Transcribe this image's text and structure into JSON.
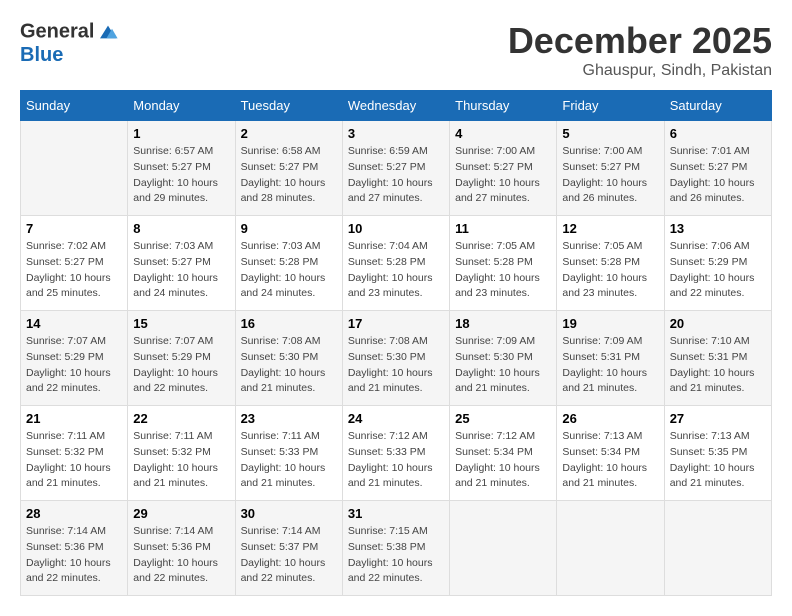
{
  "logo": {
    "line1": "General",
    "line2": "Blue"
  },
  "title": "December 2025",
  "subtitle": "Ghauspur, Sindh, Pakistan",
  "header": {
    "days": [
      "Sunday",
      "Monday",
      "Tuesday",
      "Wednesday",
      "Thursday",
      "Friday",
      "Saturday"
    ]
  },
  "weeks": [
    [
      {
        "day": "",
        "sunrise": "",
        "sunset": "",
        "daylight": ""
      },
      {
        "day": "1",
        "sunrise": "Sunrise: 6:57 AM",
        "sunset": "Sunset: 5:27 PM",
        "daylight": "Daylight: 10 hours and 29 minutes."
      },
      {
        "day": "2",
        "sunrise": "Sunrise: 6:58 AM",
        "sunset": "Sunset: 5:27 PM",
        "daylight": "Daylight: 10 hours and 28 minutes."
      },
      {
        "day": "3",
        "sunrise": "Sunrise: 6:59 AM",
        "sunset": "Sunset: 5:27 PM",
        "daylight": "Daylight: 10 hours and 27 minutes."
      },
      {
        "day": "4",
        "sunrise": "Sunrise: 7:00 AM",
        "sunset": "Sunset: 5:27 PM",
        "daylight": "Daylight: 10 hours and 27 minutes."
      },
      {
        "day": "5",
        "sunrise": "Sunrise: 7:00 AM",
        "sunset": "Sunset: 5:27 PM",
        "daylight": "Daylight: 10 hours and 26 minutes."
      },
      {
        "day": "6",
        "sunrise": "Sunrise: 7:01 AM",
        "sunset": "Sunset: 5:27 PM",
        "daylight": "Daylight: 10 hours and 26 minutes."
      }
    ],
    [
      {
        "day": "7",
        "sunrise": "Sunrise: 7:02 AM",
        "sunset": "Sunset: 5:27 PM",
        "daylight": "Daylight: 10 hours and 25 minutes."
      },
      {
        "day": "8",
        "sunrise": "Sunrise: 7:03 AM",
        "sunset": "Sunset: 5:27 PM",
        "daylight": "Daylight: 10 hours and 24 minutes."
      },
      {
        "day": "9",
        "sunrise": "Sunrise: 7:03 AM",
        "sunset": "Sunset: 5:28 PM",
        "daylight": "Daylight: 10 hours and 24 minutes."
      },
      {
        "day": "10",
        "sunrise": "Sunrise: 7:04 AM",
        "sunset": "Sunset: 5:28 PM",
        "daylight": "Daylight: 10 hours and 23 minutes."
      },
      {
        "day": "11",
        "sunrise": "Sunrise: 7:05 AM",
        "sunset": "Sunset: 5:28 PM",
        "daylight": "Daylight: 10 hours and 23 minutes."
      },
      {
        "day": "12",
        "sunrise": "Sunrise: 7:05 AM",
        "sunset": "Sunset: 5:28 PM",
        "daylight": "Daylight: 10 hours and 23 minutes."
      },
      {
        "day": "13",
        "sunrise": "Sunrise: 7:06 AM",
        "sunset": "Sunset: 5:29 PM",
        "daylight": "Daylight: 10 hours and 22 minutes."
      }
    ],
    [
      {
        "day": "14",
        "sunrise": "Sunrise: 7:07 AM",
        "sunset": "Sunset: 5:29 PM",
        "daylight": "Daylight: 10 hours and 22 minutes."
      },
      {
        "day": "15",
        "sunrise": "Sunrise: 7:07 AM",
        "sunset": "Sunset: 5:29 PM",
        "daylight": "Daylight: 10 hours and 22 minutes."
      },
      {
        "day": "16",
        "sunrise": "Sunrise: 7:08 AM",
        "sunset": "Sunset: 5:30 PM",
        "daylight": "Daylight: 10 hours and 21 minutes."
      },
      {
        "day": "17",
        "sunrise": "Sunrise: 7:08 AM",
        "sunset": "Sunset: 5:30 PM",
        "daylight": "Daylight: 10 hours and 21 minutes."
      },
      {
        "day": "18",
        "sunrise": "Sunrise: 7:09 AM",
        "sunset": "Sunset: 5:30 PM",
        "daylight": "Daylight: 10 hours and 21 minutes."
      },
      {
        "day": "19",
        "sunrise": "Sunrise: 7:09 AM",
        "sunset": "Sunset: 5:31 PM",
        "daylight": "Daylight: 10 hours and 21 minutes."
      },
      {
        "day": "20",
        "sunrise": "Sunrise: 7:10 AM",
        "sunset": "Sunset: 5:31 PM",
        "daylight": "Daylight: 10 hours and 21 minutes."
      }
    ],
    [
      {
        "day": "21",
        "sunrise": "Sunrise: 7:11 AM",
        "sunset": "Sunset: 5:32 PM",
        "daylight": "Daylight: 10 hours and 21 minutes."
      },
      {
        "day": "22",
        "sunrise": "Sunrise: 7:11 AM",
        "sunset": "Sunset: 5:32 PM",
        "daylight": "Daylight: 10 hours and 21 minutes."
      },
      {
        "day": "23",
        "sunrise": "Sunrise: 7:11 AM",
        "sunset": "Sunset: 5:33 PM",
        "daylight": "Daylight: 10 hours and 21 minutes."
      },
      {
        "day": "24",
        "sunrise": "Sunrise: 7:12 AM",
        "sunset": "Sunset: 5:33 PM",
        "daylight": "Daylight: 10 hours and 21 minutes."
      },
      {
        "day": "25",
        "sunrise": "Sunrise: 7:12 AM",
        "sunset": "Sunset: 5:34 PM",
        "daylight": "Daylight: 10 hours and 21 minutes."
      },
      {
        "day": "26",
        "sunrise": "Sunrise: 7:13 AM",
        "sunset": "Sunset: 5:34 PM",
        "daylight": "Daylight: 10 hours and 21 minutes."
      },
      {
        "day": "27",
        "sunrise": "Sunrise: 7:13 AM",
        "sunset": "Sunset: 5:35 PM",
        "daylight": "Daylight: 10 hours and 21 minutes."
      }
    ],
    [
      {
        "day": "28",
        "sunrise": "Sunrise: 7:14 AM",
        "sunset": "Sunset: 5:36 PM",
        "daylight": "Daylight: 10 hours and 22 minutes."
      },
      {
        "day": "29",
        "sunrise": "Sunrise: 7:14 AM",
        "sunset": "Sunset: 5:36 PM",
        "daylight": "Daylight: 10 hours and 22 minutes."
      },
      {
        "day": "30",
        "sunrise": "Sunrise: 7:14 AM",
        "sunset": "Sunset: 5:37 PM",
        "daylight": "Daylight: 10 hours and 22 minutes."
      },
      {
        "day": "31",
        "sunrise": "Sunrise: 7:15 AM",
        "sunset": "Sunset: 5:38 PM",
        "daylight": "Daylight: 10 hours and 22 minutes."
      },
      {
        "day": "",
        "sunrise": "",
        "sunset": "",
        "daylight": ""
      },
      {
        "day": "",
        "sunrise": "",
        "sunset": "",
        "daylight": ""
      },
      {
        "day": "",
        "sunrise": "",
        "sunset": "",
        "daylight": ""
      }
    ]
  ]
}
